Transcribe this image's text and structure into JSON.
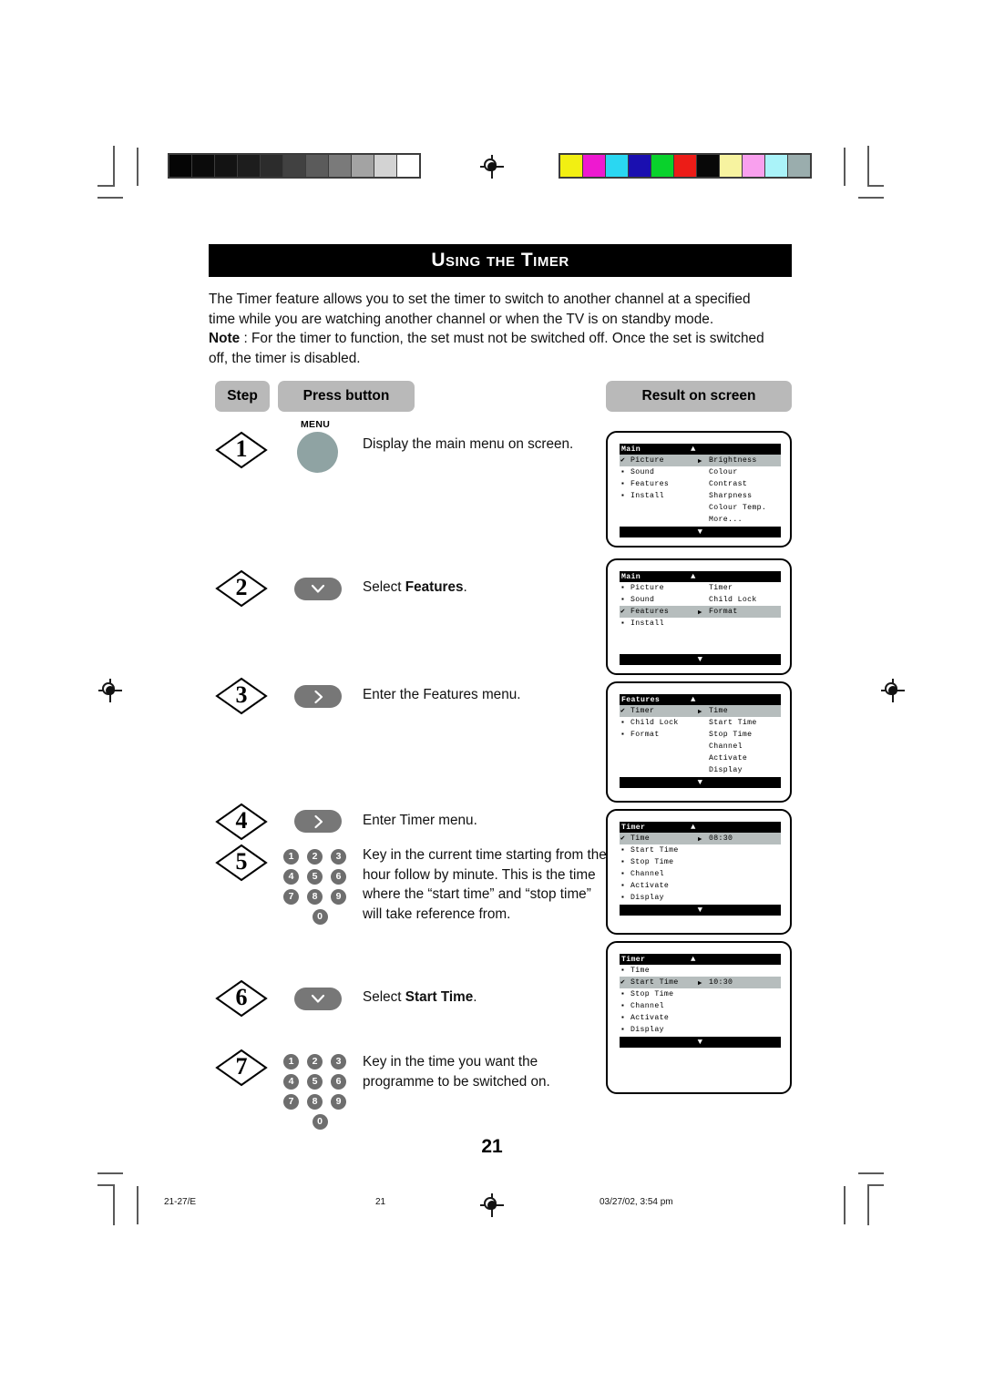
{
  "document": {
    "title": "Using the Timer",
    "page_number": "21",
    "footer": {
      "left": "21-27/E",
      "center": "21",
      "right": "03/27/02, 3:54 pm"
    }
  },
  "intro": {
    "line1": "The Timer feature allows you to set the timer to switch to another channel at a specified",
    "line2": "time while you are watching another channel or when the TV is on standby mode.",
    "note_label": "Note",
    "note_rest": " : For the timer to function, the set must not be switched off. Once the set is switched",
    "line4": "off, the timer is disabled."
  },
  "table_headers": {
    "step": "Step",
    "press_button": "Press button",
    "result_on_screen": "Result on screen"
  },
  "steps": [
    {
      "number": "1",
      "button": {
        "type": "menu-round",
        "label": "MENU",
        "icon": "menu-button-icon"
      },
      "description": "Display the main menu on screen."
    },
    {
      "number": "2",
      "button": {
        "type": "pill",
        "icon": "chevron-down-icon"
      },
      "description_plain": "Select ",
      "description_bold": "Features",
      "description_tail": "."
    },
    {
      "number": "3",
      "button": {
        "type": "pill",
        "icon": "chevron-right-icon"
      },
      "description": "Enter the Features menu."
    },
    {
      "number": "4",
      "button": {
        "type": "pill",
        "icon": "chevron-right-icon"
      },
      "description": "Enter Timer menu."
    },
    {
      "number": "5",
      "button": {
        "type": "keypad",
        "keys": [
          "1",
          "2",
          "3",
          "4",
          "5",
          "6",
          "7",
          "8",
          "9",
          "0"
        ]
      },
      "description": "Key in the current time starting from the hour follow by minute. This is the time where the “start time” and “stop time” will take reference from."
    },
    {
      "number": "6",
      "button": {
        "type": "pill",
        "icon": "chevron-down-icon"
      },
      "description_plain": "Select ",
      "description_bold": "Start Time",
      "description_tail": "."
    },
    {
      "number": "7",
      "button": {
        "type": "keypad",
        "keys": [
          "1",
          "2",
          "3",
          "4",
          "5",
          "6",
          "7",
          "8",
          "9",
          "0"
        ]
      },
      "description": "Key in the time you want the programme to be switched on."
    }
  ],
  "screens": [
    {
      "name": "main-picture",
      "title": "Main",
      "up_arrow": "▲",
      "down_arrow": "▼",
      "rows": [
        {
          "bullet": "✔",
          "left": "Picture",
          "arrow": "▶",
          "right": "Brightness",
          "highlight": true
        },
        {
          "bullet": "▪",
          "left": "Sound",
          "arrow": "",
          "right": "Colour",
          "highlight": false
        },
        {
          "bullet": "▪",
          "left": "Features",
          "arrow": "",
          "right": "Contrast",
          "highlight": false
        },
        {
          "bullet": "▪",
          "left": "Install",
          "arrow": "",
          "right": "Sharpness",
          "highlight": false
        },
        {
          "bullet": "",
          "left": "",
          "arrow": "",
          "right": "Colour Temp.",
          "highlight": false
        },
        {
          "bullet": "",
          "left": "",
          "arrow": "",
          "right": "More...",
          "highlight": false
        }
      ]
    },
    {
      "name": "main-features",
      "title": "Main",
      "up_arrow": "▲",
      "down_arrow": "▼",
      "rows": [
        {
          "bullet": "▪",
          "left": "Picture",
          "arrow": "",
          "right": "Timer",
          "highlight": false
        },
        {
          "bullet": "▪",
          "left": "Sound",
          "arrow": "",
          "right": "Child Lock",
          "highlight": false
        },
        {
          "bullet": "✔",
          "left": "Features",
          "arrow": "▶",
          "right": "Format",
          "highlight": true
        },
        {
          "bullet": "▪",
          "left": "Install",
          "arrow": "",
          "right": "",
          "highlight": false
        },
        {
          "bullet": "",
          "left": "",
          "arrow": "",
          "right": "",
          "highlight": false
        },
        {
          "bullet": "",
          "left": "",
          "arrow": "",
          "right": "",
          "highlight": false
        }
      ]
    },
    {
      "name": "features-timer",
      "title": "Features",
      "up_arrow": "▲",
      "down_arrow": "▼",
      "rows": [
        {
          "bullet": "✔",
          "left": "Timer",
          "arrow": "▶",
          "right": "Time",
          "highlight": true
        },
        {
          "bullet": "▪",
          "left": "Child Lock",
          "arrow": "",
          "right": "Start Time",
          "highlight": false
        },
        {
          "bullet": "▪",
          "left": "Format",
          "arrow": "",
          "right": "Stop Time",
          "highlight": false
        },
        {
          "bullet": "",
          "left": "",
          "arrow": "",
          "right": "Channel",
          "highlight": false
        },
        {
          "bullet": "",
          "left": "",
          "arrow": "",
          "right": "Activate",
          "highlight": false
        },
        {
          "bullet": "",
          "left": "",
          "arrow": "",
          "right": "Display",
          "highlight": false
        }
      ]
    },
    {
      "name": "timer-time",
      "title": "Timer",
      "up_arrow": "▲",
      "down_arrow": "▼",
      "rows": [
        {
          "bullet": "✔",
          "left": "Time",
          "arrow": "▶",
          "right": "08:30",
          "highlight": true
        },
        {
          "bullet": "▪",
          "left": "Start Time",
          "arrow": "",
          "right": "",
          "highlight": false
        },
        {
          "bullet": "▪",
          "left": "Stop Time",
          "arrow": "",
          "right": "",
          "highlight": false
        },
        {
          "bullet": "▪",
          "left": "Channel",
          "arrow": "",
          "right": "",
          "highlight": false
        },
        {
          "bullet": "▪",
          "left": "Activate",
          "arrow": "",
          "right": "",
          "highlight": false
        },
        {
          "bullet": "▪",
          "left": "Display",
          "arrow": "",
          "right": "",
          "highlight": false
        }
      ]
    },
    {
      "name": "timer-start-time",
      "title": "Timer",
      "up_arrow": "▲",
      "down_arrow": "▼",
      "rows": [
        {
          "bullet": "▪",
          "left": "Time",
          "arrow": "",
          "right": "",
          "highlight": false
        },
        {
          "bullet": "✔",
          "left": "Start Time",
          "arrow": "▶",
          "right": "10:30",
          "highlight": true
        },
        {
          "bullet": "▪",
          "left": "Stop Time",
          "arrow": "",
          "right": "",
          "highlight": false
        },
        {
          "bullet": "▪",
          "left": "Channel",
          "arrow": "",
          "right": "",
          "highlight": false
        },
        {
          "bullet": "▪",
          "left": "Activate",
          "arrow": "",
          "right": "",
          "highlight": false
        },
        {
          "bullet": "▪",
          "left": "Display",
          "arrow": "",
          "right": "",
          "highlight": false
        }
      ]
    }
  ],
  "calibration": {
    "grayscale": [
      "#050505",
      "#0b0b0b",
      "#131313",
      "#1d1d1d",
      "#2c2c2c",
      "#414141",
      "#5b5b5b",
      "#7a7a7a",
      "#a3a3a3",
      "#d3d3d3",
      "#ffffff"
    ],
    "colors": [
      "#f2ef12",
      "#ee19d0",
      "#2ad7f2",
      "#1a0fb0",
      "#09d22c",
      "#ec1c17",
      "#080808",
      "#f7f3a0",
      "#f9a0ee",
      "#aaf3f9",
      "#9aadad"
    ]
  }
}
